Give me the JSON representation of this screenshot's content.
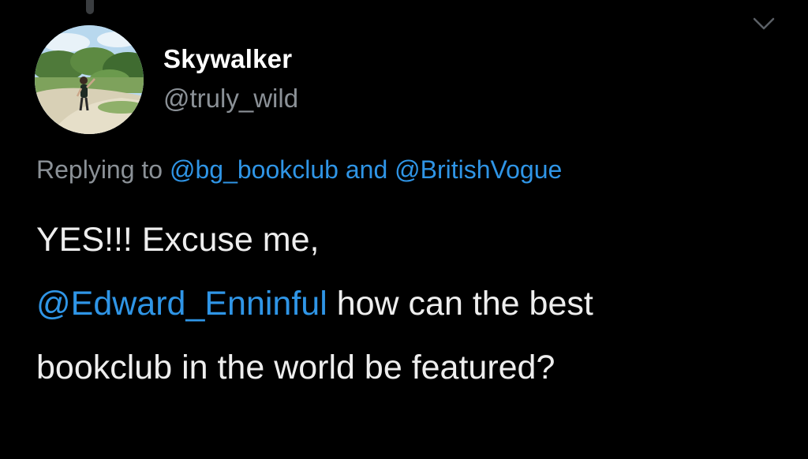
{
  "colors": {
    "background": "#000000",
    "text": "#eeeeee",
    "secondary_text": "#8b9197",
    "link": "#2f95e6"
  },
  "tweet": {
    "user": {
      "display_name": "Skywalker",
      "handle": "@truly_wild",
      "avatar": "avatar-photo-person-on-sandy-path"
    },
    "reply_context": {
      "prefix": "Replying to",
      "mentions": [
        "@bg_bookclub",
        "@BritishVogue"
      ],
      "joiner": "and"
    },
    "body": {
      "line1": "YES!!! Excuse me,",
      "line2_mention": "@Edward_Enninful",
      "line2_text": " how can the best",
      "line3": "bookclub in the world be featured?"
    },
    "menu_icon": "chevron-down-icon"
  }
}
